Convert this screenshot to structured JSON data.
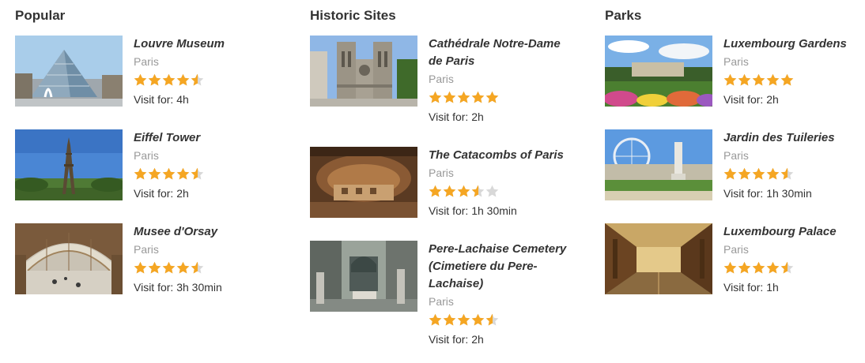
{
  "columns": [
    {
      "title": "Popular",
      "items": [
        {
          "name": "Louvre Museum",
          "city": "Paris",
          "rating": 4.5,
          "visit": "Visit for: 4h",
          "image": "louvre-pyramid"
        },
        {
          "name": "Eiffel Tower",
          "city": "Paris",
          "rating": 4.5,
          "visit": "Visit for: 2h",
          "image": "eiffel-tower"
        },
        {
          "name": "Musee d'Orsay",
          "city": "Paris",
          "rating": 4.5,
          "visit": "Visit for: 3h 30min",
          "image": "orsay-hall"
        }
      ]
    },
    {
      "title": "Historic Sites",
      "items": [
        {
          "name": "Cathédrale Notre-Dame de Paris",
          "city": "Paris",
          "rating": 5,
          "visit": "Visit for: 2h",
          "image": "notre-dame"
        },
        {
          "name": "The Catacombs of Paris",
          "city": "Paris",
          "rating": 3.5,
          "visit": "Visit for: 1h 30min",
          "image": "catacombs"
        },
        {
          "name": "Pere-Lachaise Cemetery (Cimetiere du Pere-Lachaise)",
          "city": "Paris",
          "rating": 4.5,
          "visit": "Visit for: 2h",
          "image": "cemetery"
        }
      ]
    },
    {
      "title": "Parks",
      "items": [
        {
          "name": "Luxembourg Gardens",
          "city": "Paris",
          "rating": 5,
          "visit": "Visit for: 2h",
          "image": "luxembourg-gardens"
        },
        {
          "name": "Jardin des Tuileries",
          "city": "Paris",
          "rating": 4.5,
          "visit": "Visit for: 1h 30min",
          "image": "tuileries"
        },
        {
          "name": "Luxembourg Palace",
          "city": "Paris",
          "rating": 4.5,
          "visit": "Visit for: 1h",
          "image": "palace-library"
        }
      ]
    }
  ],
  "colors": {
    "star_filled": "#f5a623",
    "star_empty": "#d8d8d8",
    "city": "#999999",
    "text": "#333333"
  }
}
